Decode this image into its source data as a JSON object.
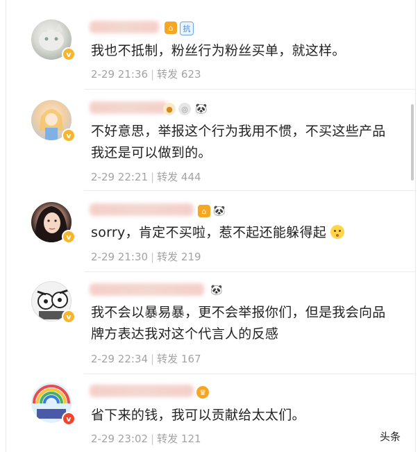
{
  "comments": [
    {
      "text": "我也不抵制，粉丝行为粉丝买单，就这样。",
      "date": "2-29 21:36",
      "repost_label": "转发",
      "repost_count": "623"
    },
    {
      "text": "不好意思，举报这个行为我用不惯，不买这些产品我还是可以做到的。",
      "date": "2-29 22:21",
      "repost_label": "转发",
      "repost_count": "444"
    },
    {
      "text": "sorry，肯定不买啦，惹不起还能躲得起",
      "date": "2-29 21:30",
      "repost_label": "转发",
      "repost_count": "219"
    },
    {
      "text": "我不会以暴易暴，更不会举报你们，但是我会向品牌方表达我对这个代言人的反感",
      "date": "2-29 22:34",
      "repost_label": "转发",
      "repost_count": "167"
    },
    {
      "text": "省下来的钱，我可以贡献给太太们。",
      "date": "2-29 23:02",
      "repost_label": "转发",
      "repost_count": "121"
    }
  ],
  "watermark": "头条",
  "colors": {
    "verified_gold": "#f6b52b",
    "verified_red": "#f0452c",
    "meta": "#a3a3a3"
  }
}
